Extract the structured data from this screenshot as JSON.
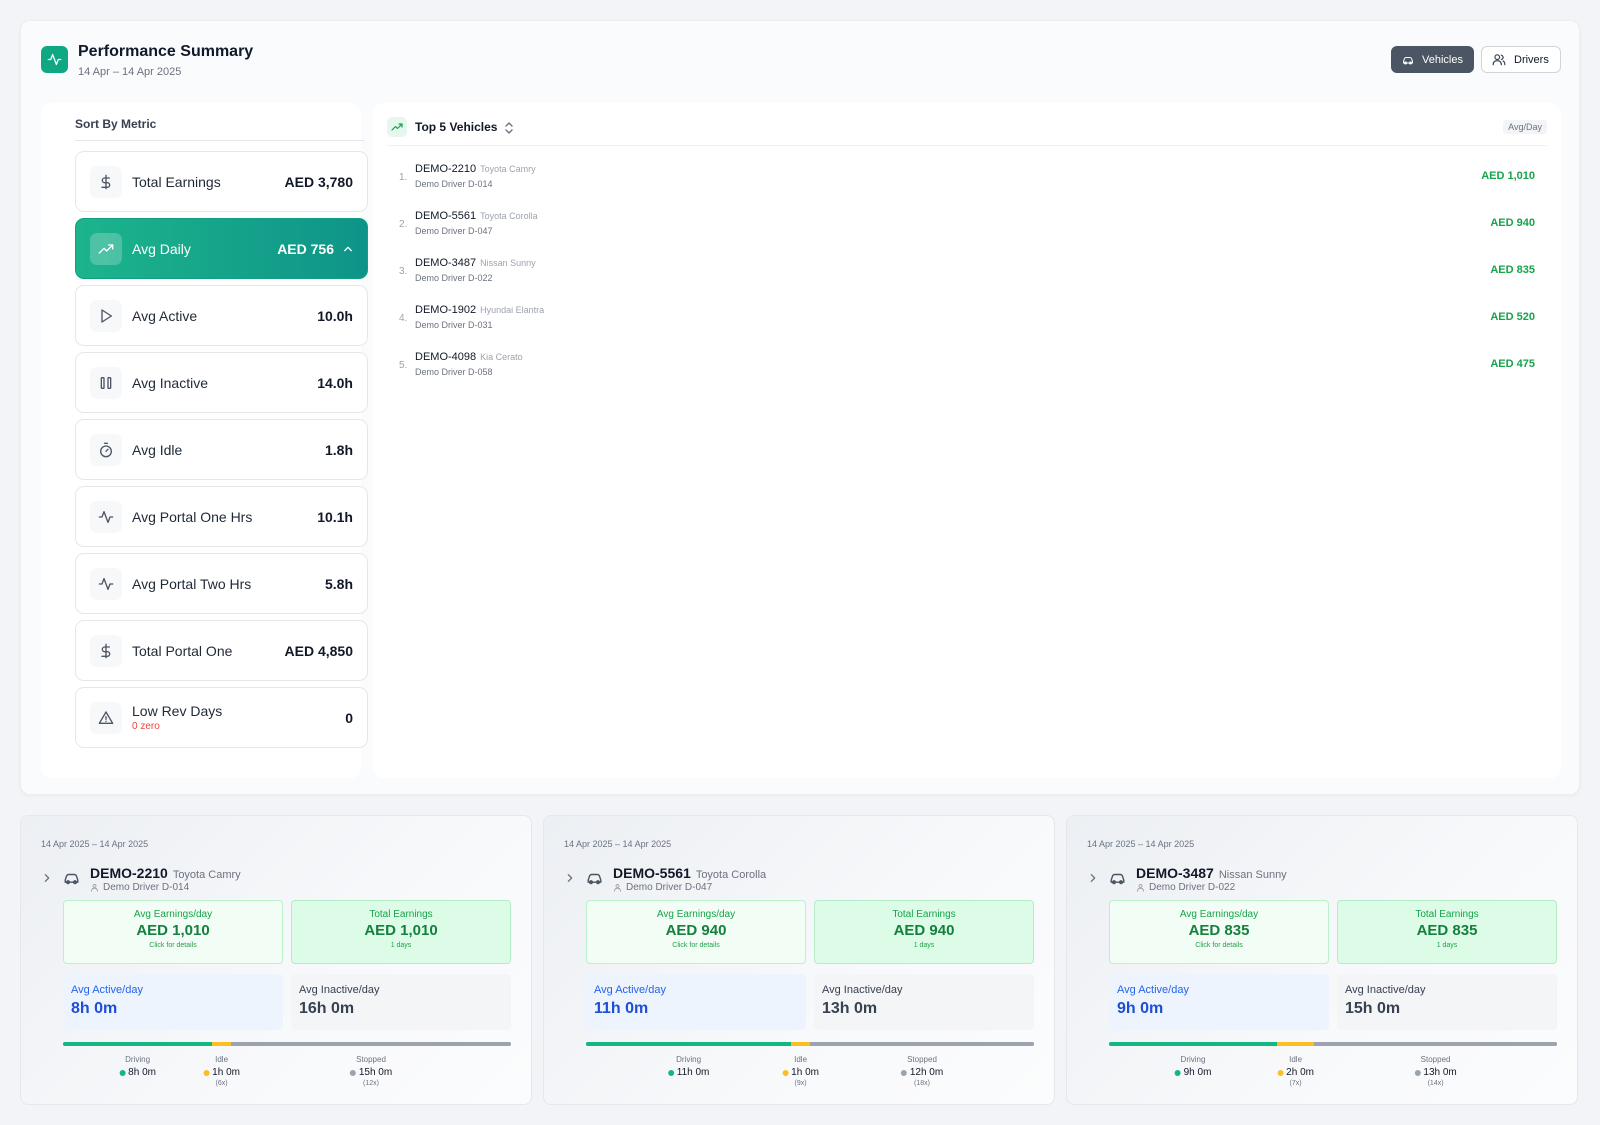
{
  "header": {
    "title": "Performance Summary",
    "date_range": "14 Apr – 14 Apr 2025",
    "toggles": {
      "vehicles": "Vehicles",
      "drivers": "Drivers"
    }
  },
  "sort_panel": {
    "title": "Sort By Metric",
    "metrics": [
      {
        "label": "Total Earnings",
        "value": "AED 3,780",
        "icon": "dollar-icon"
      },
      {
        "label": "Avg Daily",
        "value": "AED 756",
        "icon": "trending-up-icon",
        "active": true
      },
      {
        "label": "Avg Active",
        "value": "10.0h",
        "icon": "play-icon"
      },
      {
        "label": "Avg Inactive",
        "value": "14.0h",
        "icon": "pause-icon"
      },
      {
        "label": "Avg Idle",
        "value": "1.8h",
        "icon": "timer-icon"
      },
      {
        "label": "Avg Portal One Hrs",
        "value": "10.1h",
        "icon": "activity-icon"
      },
      {
        "label": "Avg Portal Two Hrs",
        "value": "5.8h",
        "icon": "activity-icon"
      },
      {
        "label": "Total Portal One",
        "value": "AED 4,850",
        "icon": "dollar-icon"
      },
      {
        "label": "Low Rev Days",
        "value": "0",
        "sub": "0 zero",
        "icon": "warning-icon"
      }
    ]
  },
  "top_vehicles": {
    "title": "Top 5 Vehicles",
    "badge": "Avg/Day",
    "rows": [
      {
        "rank": "1.",
        "plate": "DEMO-2210",
        "model": "Toyota Camry",
        "driver": "Demo Driver D-014",
        "amount": "AED 1,010"
      },
      {
        "rank": "2.",
        "plate": "DEMO-5561",
        "model": "Toyota Corolla",
        "driver": "Demo Driver D-047",
        "amount": "AED 940"
      },
      {
        "rank": "3.",
        "plate": "DEMO-3487",
        "model": "Nissan Sunny",
        "driver": "Demo Driver D-022",
        "amount": "AED 835"
      },
      {
        "rank": "4.",
        "plate": "DEMO-1902",
        "model": "Hyundai Elantra",
        "driver": "Demo Driver D-031",
        "amount": "AED 520"
      },
      {
        "rank": "5.",
        "plate": "DEMO-4098",
        "model": "Kia Cerato",
        "driver": "Demo Driver D-058",
        "amount": "AED 475"
      }
    ]
  },
  "cards": [
    {
      "date": "14 Apr 2025 – 14 Apr 2025",
      "plate": "DEMO-2210",
      "model": "Toyota Camry",
      "driver": "Demo Driver D-014",
      "avg_label": "Avg Earnings/day",
      "avg_value": "AED 1,010",
      "avg_sub": "Click for details",
      "total_label": "Total Earnings",
      "total_value": "AED 1,010",
      "total_sub": "1 days",
      "active_label": "Avg Active/day",
      "active_value": "8h 0m",
      "inactive_label": "Avg Inactive/day",
      "inactive_value": "16h 0m",
      "driving_pct": 33.3,
      "idle_pct": 4.2,
      "legend": {
        "driving": {
          "label": "Driving",
          "value": "8h 0m",
          "count": ""
        },
        "idle": {
          "label": "Idle",
          "value": "1h 0m",
          "count": "(6x)"
        },
        "stopped": {
          "label": "Stopped",
          "value": "15h 0m",
          "count": "(12x)"
        }
      }
    },
    {
      "date": "14 Apr 2025 – 14 Apr 2025",
      "plate": "DEMO-5561",
      "model": "Toyota Corolla",
      "driver": "Demo Driver D-047",
      "avg_label": "Avg Earnings/day",
      "avg_value": "AED 940",
      "avg_sub": "Click for details",
      "total_label": "Total Earnings",
      "total_value": "AED 940",
      "total_sub": "1 days",
      "active_label": "Avg Active/day",
      "active_value": "11h 0m",
      "inactive_label": "Avg Inactive/day",
      "inactive_value": "13h 0m",
      "driving_pct": 45.8,
      "idle_pct": 4.2,
      "legend": {
        "driving": {
          "label": "Driving",
          "value": "11h 0m",
          "count": ""
        },
        "idle": {
          "label": "Idle",
          "value": "1h 0m",
          "count": "(9x)"
        },
        "stopped": {
          "label": "Stopped",
          "value": "12h 0m",
          "count": "(18x)"
        }
      }
    },
    {
      "date": "14 Apr 2025 – 14 Apr 2025",
      "plate": "DEMO-3487",
      "model": "Nissan Sunny",
      "driver": "Demo Driver D-022",
      "avg_label": "Avg Earnings/day",
      "avg_value": "AED 835",
      "avg_sub": "Click for details",
      "total_label": "Total Earnings",
      "total_value": "AED 835",
      "total_sub": "1 days",
      "active_label": "Avg Active/day",
      "active_value": "9h 0m",
      "inactive_label": "Avg Inactive/day",
      "inactive_value": "15h 0m",
      "driving_pct": 37.5,
      "idle_pct": 8.3,
      "legend": {
        "driving": {
          "label": "Driving",
          "value": "9h 0m",
          "count": ""
        },
        "idle": {
          "label": "Idle",
          "value": "2h 0m",
          "count": "(7x)"
        },
        "stopped": {
          "label": "Stopped",
          "value": "13h 0m",
          "count": "(14x)"
        }
      }
    }
  ],
  "colors": {
    "accent": "#10a882",
    "earnings_green": "#16a34a",
    "active_blue": "#1d4ed8",
    "driving": "#10b981",
    "idle": "#fbbf24",
    "stopped": "#9ca3af",
    "warning_red": "#ef4444"
  }
}
